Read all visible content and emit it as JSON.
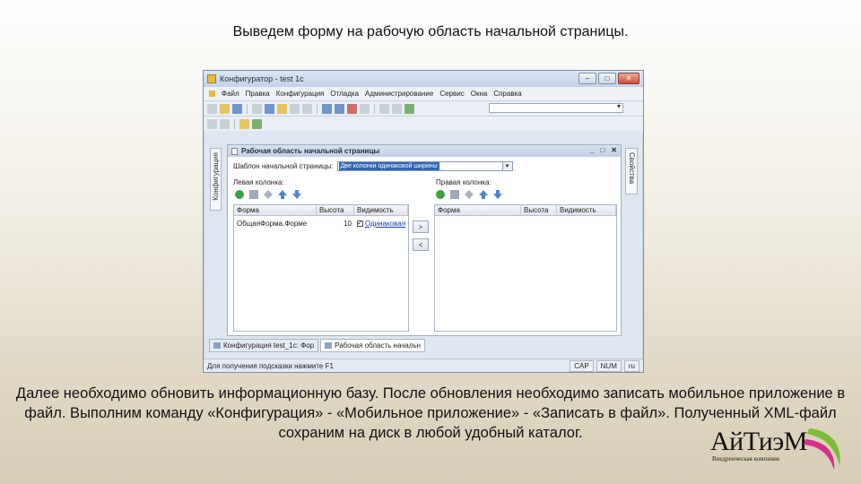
{
  "slide": {
    "title": "Выведем форму на рабочую область начальной страницы.",
    "paragraph": "Далее необходимо обновить информационную базу. После обновления необходимо записать мобильное приложение в файл. Выполним команду «Конфигурация» - «Мобильное приложение» - «Записать в файл». Полученный XML-файл сохраним на диск в любой удобный каталог."
  },
  "window": {
    "title": "Конфигуратор - test 1c",
    "buttons": {
      "minimize": "–",
      "maximize": "□",
      "close": "✕"
    }
  },
  "menu": [
    "Файл",
    "Правка",
    "Конфигурация",
    "Отладка",
    "Администрирование",
    "Сервис",
    "Окна",
    "Справка"
  ],
  "side_panels": {
    "left": "Конфигурация",
    "right": "Свойства"
  },
  "document": {
    "title": "Рабочая область начальной страницы",
    "controls": {
      "minimize": "_",
      "maximize": "□",
      "close": "✕"
    },
    "template_label": "Шаблон начальной страницы:",
    "template_value": "Две колонки одинаковой ширины",
    "left_column_label": "Левая колонка:",
    "right_column_label": "Правая колонка:",
    "left_grid": {
      "headers": [
        "Форма",
        "Высота",
        "Видимость"
      ],
      "rows": [
        {
          "form": "ОбщаяФорма.Форме",
          "height": "10",
          "visibility": "Одинаковая"
        }
      ]
    },
    "right_grid": {
      "headers": [
        "Форма",
        "Высота",
        "Видимость"
      ]
    },
    "move_right": ">",
    "move_left": "<"
  },
  "tabs": [
    {
      "label": "Конфигурация test_1c: Фор",
      "active": false
    },
    {
      "label": "Рабочая область начальн",
      "active": true
    }
  ],
  "status": {
    "hint": "Для получения подсказки нажмите F1",
    "cap": "CAP",
    "num": "NUM",
    "lang": "ru"
  },
  "logo": {
    "name": "АйТиэМ",
    "subtitle": "Внедренческая компания"
  },
  "colors": {
    "accent": "#3166b5",
    "logo_pink": "#d4318b",
    "logo_green": "#7dbb3a"
  }
}
